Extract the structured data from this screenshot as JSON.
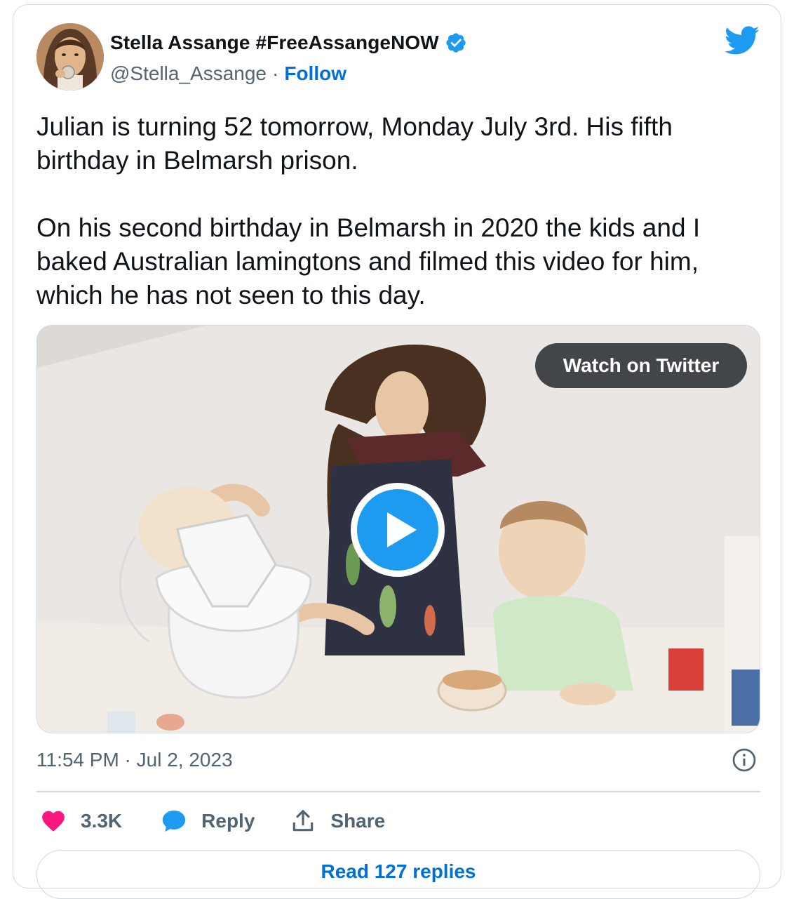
{
  "author": {
    "display_name": "Stella Assange #FreeAssangeNOW",
    "handle": "@Stella_Assange",
    "separator": "·",
    "follow_label": "Follow",
    "verified": true
  },
  "tweet": {
    "paragraphs": [
      "Julian is turning 52 tomorrow, Monday July 3rd. His fifth birthday in Belmarsh prison.",
      "On his second birthday in Belmarsh in 2020 the kids and I baked Australian lamingtons and filmed this video for him, which he has not seen to this day."
    ]
  },
  "media": {
    "watch_label": "Watch on Twitter",
    "play_icon": "play-icon"
  },
  "timestamp": "11:54 PM · Jul 2, 2023",
  "actions": {
    "like_count": "3.3K",
    "reply_label": "Reply",
    "share_label": "Share"
  },
  "read_replies_label": "Read 127 replies",
  "colors": {
    "link_blue": "#006fd6",
    "twitter_blue": "#1d9bf0",
    "like_pink": "#f91880",
    "text_primary": "#0f1419",
    "text_secondary": "#536471",
    "border": "#cfd9de"
  }
}
